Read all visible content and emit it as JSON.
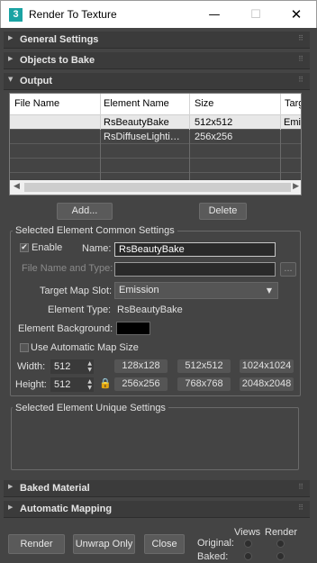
{
  "window": {
    "title": "Render To Texture",
    "app_icon_glyph": "3",
    "minimize_glyph": "—",
    "maximize_glyph": "☐",
    "close_glyph": "✕"
  },
  "rollouts": {
    "general_settings": "General Settings",
    "objects_to_bake": "Objects to Bake",
    "output": "Output",
    "baked_material": "Baked Material",
    "automatic_mapping": "Automatic Mapping"
  },
  "output_table": {
    "columns": [
      "File Name",
      "Element Name",
      "Size",
      "Targ"
    ],
    "rows": [
      {
        "file_name": "",
        "element_name": "RsBeautyBake",
        "size": "512x512",
        "target": "Emis"
      },
      {
        "file_name": "",
        "element_name": "RsDiffuseLighti…",
        "size": "256x256",
        "target": ""
      }
    ]
  },
  "buttons": {
    "add": "Add...",
    "delete": "Delete",
    "render": "Render",
    "unwrap_only": "Unwrap Only",
    "close": "Close",
    "ellipsis": "..."
  },
  "common_settings": {
    "group_title": "Selected Element Common Settings",
    "enable_label": "Enable",
    "enable_checked": true,
    "name_label": "Name:",
    "name_value": "RsBeautyBake",
    "file_label": "File Name and Type:",
    "file_value": "",
    "target_slot_label": "Target Map Slot:",
    "target_slot_value": "Emission",
    "element_type_label": "Element Type:",
    "element_type_value": "RsBeautyBake",
    "element_bg_label": "Element Background:",
    "element_bg_color": "#000000",
    "auto_map_size_label": "Use Automatic Map Size",
    "auto_map_size_checked": false,
    "width_label": "Width:",
    "width_value": "512",
    "height_label": "Height:",
    "height_value": "512",
    "presets": [
      "128x128",
      "512x512",
      "1024x1024",
      "256x256",
      "768x768",
      "2048x2048"
    ]
  },
  "unique_settings": {
    "group_title": "Selected Element Unique Settings"
  },
  "bottom": {
    "views_label": "Views",
    "render_label": "Render",
    "original_label": "Original:",
    "baked_label": "Baked:"
  }
}
